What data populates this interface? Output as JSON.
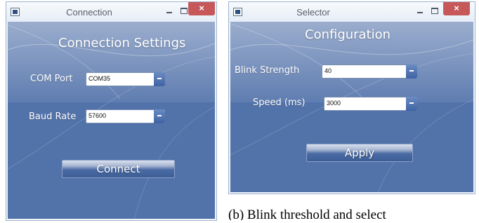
{
  "connection_window": {
    "title": "Connection",
    "heading": "Connection Settings",
    "com_port_label": "COM Port",
    "com_port_value": "COM35",
    "baud_rate_label": "Baud Rate",
    "baud_rate_value": "57600",
    "connect_button": "Connect",
    "close_glyph": "×"
  },
  "selector_window": {
    "title": "Selector",
    "heading": "Configuration",
    "blink_strength_label": "Blink Strength",
    "blink_strength_value": "40",
    "speed_label": "Speed (ms)",
    "speed_value": "3000",
    "apply_button": "Apply",
    "close_glyph": "×"
  },
  "caption": "(b) Blink threshold and select",
  "colors": {
    "client_background": "#5272aa",
    "close_button": "#c7585a",
    "window_border": "#9eb3cf"
  },
  "icons": [
    "app-icon",
    "minimize-icon",
    "maximize-icon",
    "close-icon",
    "dropdown-arrow-icon"
  ]
}
